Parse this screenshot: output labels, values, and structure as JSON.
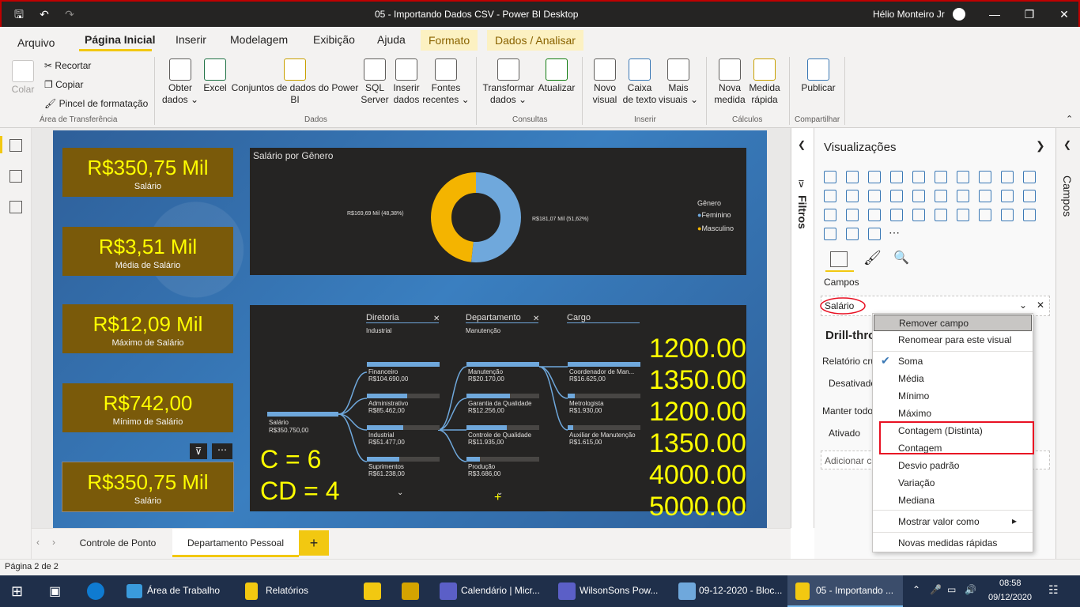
{
  "titlebar": {
    "title": "05 - Importando Dados CSV - Power BI Desktop",
    "user": "Hélio Monteiro Jr"
  },
  "menu_tabs": [
    "Arquivo",
    "Página Inicial",
    "Inserir",
    "Modelagem",
    "Exibição",
    "Ajuda",
    "Formato",
    "Dados / Analisar"
  ],
  "ribbon": {
    "clipboard": {
      "paste": "Colar",
      "cut": "Recortar",
      "copy": "Copiar",
      "format_painter": "Pincel de formatação",
      "group": "Área de Transferência"
    },
    "data": {
      "get_data": "Obter dados",
      "excel": "Excel",
      "datasets": "Conjuntos de dados do Power BI",
      "sql": "SQL Server",
      "enter_data": "Inserir dados",
      "recent": "Fontes recentes",
      "group": "Dados"
    },
    "queries": {
      "transform": "Transformar dados",
      "refresh": "Atualizar",
      "group": "Consultas"
    },
    "insert": {
      "new_visual": "Novo visual",
      "textbox": "Caixa de texto",
      "more_visuals": "Mais visuais",
      "group": "Inserir"
    },
    "calcs": {
      "new_measure": "Nova medida",
      "quick_measure": "Medida rápida",
      "group": "Cálculos"
    },
    "share": {
      "publish": "Publicar",
      "group": "Compartilhar"
    }
  },
  "cards": [
    {
      "value": "R$350,75 Mil",
      "label": "Salário"
    },
    {
      "value": "R$3,51 Mil",
      "label": "Média de Salário"
    },
    {
      "value": "R$12,09 Mil",
      "label": "Máximo de Salário"
    },
    {
      "value": "R$742,00",
      "label": "Mínimo de Salário"
    },
    {
      "value": "R$350,75 Mil",
      "label": "Salário"
    }
  ],
  "donut": {
    "title": "Salário por Gênero",
    "legend_title": "Gênero",
    "legend": [
      {
        "name": "Feminino",
        "color": "#6fa8dc"
      },
      {
        "name": "Masculino",
        "color": "#f4b400"
      }
    ],
    "label_left": "R$169,69 Mil (48,38%)",
    "label_right": "R$181,07 Mil (51,62%)",
    "values": [
      181.07,
      169.69
    ]
  },
  "tree": {
    "root_label": "Salário",
    "root_value": "R$350.750,00",
    "col1": {
      "header": "Diretoria",
      "sub": "Industrial"
    },
    "col2": {
      "header": "Departamento",
      "sub": "Manutenção"
    },
    "col3": {
      "header": "Cargo"
    },
    "nodes1": [
      {
        "name": "Financeiro",
        "value": "R$104.690,00"
      },
      {
        "name": "Administrativo",
        "value": "R$85.462,00"
      },
      {
        "name": "Industrial",
        "value": "R$51.477,00"
      },
      {
        "name": "Suprimentos",
        "value": "R$61.238,00"
      }
    ],
    "nodes2": [
      {
        "name": "Manutenção",
        "value": "R$20.170,00"
      },
      {
        "name": "Garantia da Qualidade",
        "value": "R$12.256,00"
      },
      {
        "name": "Controle de Qualidade",
        "value": "R$11.935,00"
      },
      {
        "name": "Produção",
        "value": "R$3.686,00"
      }
    ],
    "nodes3": [
      {
        "name": "Coordenador de Man...",
        "value": "R$16.625,00"
      },
      {
        "name": "Metrologista",
        "value": "R$1.930,00"
      },
      {
        "name": "Auxiliar de Manutenção",
        "value": "R$1.615,00"
      }
    ]
  },
  "annotations": {
    "c": "C = 6",
    "cd": "CD = 4",
    "numbers": [
      "1200.00",
      "1350.00",
      "1200.00",
      "1350.00",
      "4000.00",
      "5000.00"
    ],
    "plus": "+"
  },
  "filters_label": "Filtros",
  "viz_pane": {
    "title": "Visualizações",
    "campos_label": "Campos",
    "field": "Salário",
    "drill": "Drill-thro",
    "cross_report": "Relatório cru",
    "disabled": "Desativado",
    "keep_all": "Manter todo",
    "enabled": "Ativado",
    "add": "Adicionar c"
  },
  "campos_side": "Campos",
  "context_menu": {
    "items_top": [
      "Remover campo",
      "Renomear para este visual"
    ],
    "aggregations": [
      "Soma",
      "Média",
      "Mínimo",
      "Máximo",
      "Contagem (Distinta)",
      "Contagem",
      "Desvio padrão",
      "Variação",
      "Mediana"
    ],
    "show_as": "Mostrar valor como",
    "quick": "Novas medidas rápidas",
    "checked": "Soma"
  },
  "page_tabs": [
    "Controle de Ponto",
    "Departamento Pessoal"
  ],
  "add_tab": "+",
  "status": "Página 2 de 2",
  "taskbar": {
    "items": [
      "Área de Trabalho",
      "Relatórios",
      "Calendário | Micr...",
      "WilsonSons Pow...",
      "09-12-2020 - Bloc...",
      "05 - Importando ..."
    ],
    "time": "08:58",
    "date": "09/12/2020"
  },
  "colors": {
    "accent": "#f2c811",
    "card_bg": "#7a5a0a",
    "card_text": "#ffff00",
    "highlight": "#e81123"
  }
}
